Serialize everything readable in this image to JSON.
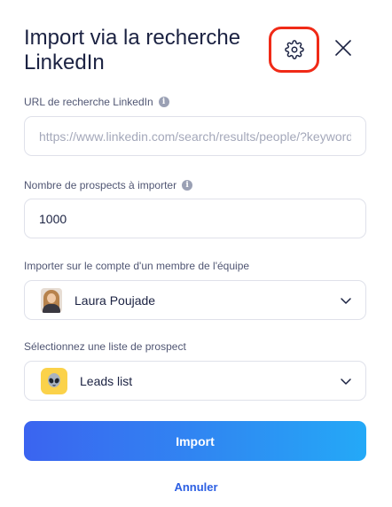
{
  "dialog": {
    "title": "Import via la recherche LinkedIn",
    "settings_icon": "gear-icon",
    "close_icon": "close-icon"
  },
  "fields": {
    "url": {
      "label": "URL de recherche LinkedIn",
      "placeholder": "https://www.linkedin.com/search/results/people/?keywords=",
      "value": ""
    },
    "count": {
      "label": "Nombre de prospects à importer",
      "value": "1000"
    },
    "member": {
      "label": "Importer sur le compte d'un membre de l'équipe",
      "selected": "Laura Poujade"
    },
    "list": {
      "label": "Sélectionnez une liste de prospect",
      "selected": "Leads list"
    }
  },
  "actions": {
    "import_label": "Import",
    "cancel_label": "Annuler"
  },
  "colors": {
    "accent": "#2c5fe3",
    "highlight": "#f02a17",
    "list_icon_bg": "#fbd24a"
  }
}
